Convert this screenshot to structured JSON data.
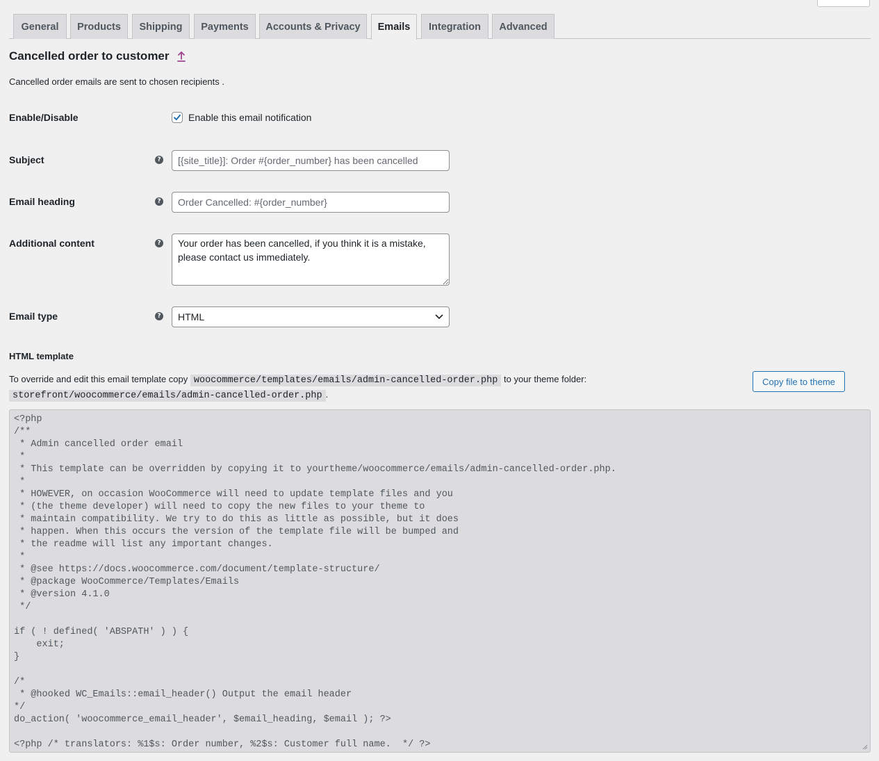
{
  "tabs": [
    {
      "label": "General",
      "active": false
    },
    {
      "label": "Products",
      "active": false
    },
    {
      "label": "Shipping",
      "active": false
    },
    {
      "label": "Payments",
      "active": false
    },
    {
      "label": "Accounts & Privacy",
      "active": false
    },
    {
      "label": "Emails",
      "active": true
    },
    {
      "label": "Integration",
      "active": false
    },
    {
      "label": "Advanced",
      "active": false
    }
  ],
  "page": {
    "title": "Cancelled order to customer",
    "up_icon": "up-arrow-icon",
    "description": "Cancelled order emails are sent to chosen recipients ."
  },
  "form": {
    "enable": {
      "label": "Enable/Disable",
      "checkbox_label": "Enable this email notification",
      "checked": true
    },
    "subject": {
      "label": "Subject",
      "placeholder": "[{site_title}]: Order #{order_number} has been cancelled",
      "value": ""
    },
    "heading": {
      "label": "Email heading",
      "placeholder": "Order Cancelled: #{order_number}",
      "value": ""
    },
    "additional": {
      "label": "Additional content",
      "value": "Your order has been cancelled, if you think it is a mistake, please contact us immediately."
    },
    "email_type": {
      "label": "Email type",
      "value": "HTML"
    },
    "help_icon": "question-mark-icon"
  },
  "template": {
    "heading": "HTML template",
    "override_prefix": "To override and edit this email template copy",
    "source_path": "woocommerce/templates/emails/admin-cancelled-order.php",
    "override_middle": "to your theme folder:",
    "theme_path": "storefront/woocommerce/emails/admin-cancelled-order.php",
    "override_suffix": ".",
    "copy_button": "Copy file to theme",
    "code": "<?php\n/**\n * Admin cancelled order email\n *\n * This template can be overridden by copying it to yourtheme/woocommerce/emails/admin-cancelled-order.php.\n *\n * HOWEVER, on occasion WooCommerce will need to update template files and you\n * (the theme developer) will need to copy the new files to your theme to\n * maintain compatibility. We try to do this as little as possible, but it does\n * happen. When this occurs the version of the template file will be bumped and\n * the readme will list any important changes.\n *\n * @see https://docs.woocommerce.com/document/template-structure/\n * @package WooCommerce/Templates/Emails\n * @version 4.1.0\n */\n\nif ( ! defined( 'ABSPATH' ) ) {\n    exit;\n}\n\n/*\n * @hooked WC_Emails::email_header() Output the email header\n*/\ndo_action( 'woocommerce_email_header', $email_heading, $email ); ?>\n\n<?php /* translators: %1$s: Order number, %2$s: Customer full name.  */ ?>"
  },
  "colors": {
    "accent": "#2271b1",
    "link": "#a0448f"
  }
}
